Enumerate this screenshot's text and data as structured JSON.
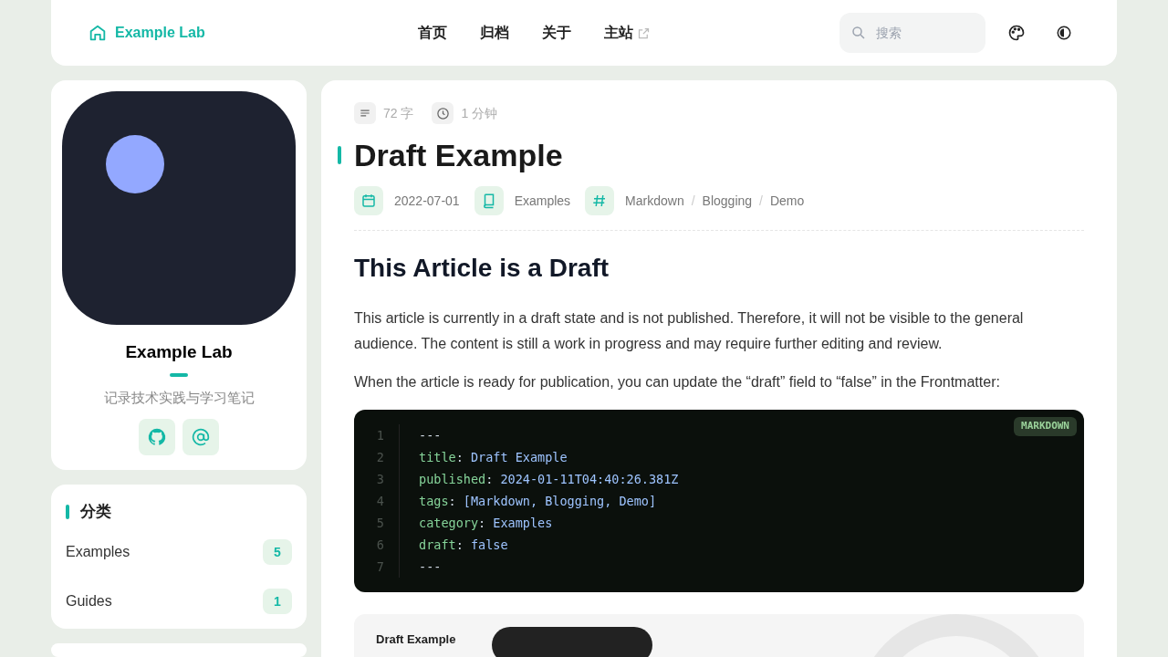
{
  "navbar": {
    "brand": "Example Lab",
    "links": [
      {
        "label": "首页",
        "external": false
      },
      {
        "label": "归档",
        "external": false
      },
      {
        "label": "关于",
        "external": false
      },
      {
        "label": "主站",
        "external": true
      }
    ],
    "search": {
      "placeholder": "搜索"
    }
  },
  "profile": {
    "name": "Example Lab",
    "bio": "记录技术实践与学习笔记"
  },
  "categories": {
    "title": "分类",
    "items": [
      {
        "name": "Examples",
        "count": "5"
      },
      {
        "name": "Guides",
        "count": "1"
      }
    ]
  },
  "post": {
    "words": "72 字",
    "reading_time": "1 分钟",
    "title": "Draft Example",
    "date": "2022-07-01",
    "category": "Examples",
    "tags": [
      "Markdown",
      "Blogging",
      "Demo"
    ],
    "tag_separator": "/",
    "heading": "This Article is a Draft",
    "paragraphs": [
      "This article is currently in a draft state and is not published. Therefore, it will not be visible to the general audience. The content is still a work in progress and may require further editing and review.",
      "When the article is ready for publication, you can update the “draft” field to “false” in the Frontmatter:"
    ],
    "code": {
      "language": "MARKDOWN",
      "lines": [
        {
          "number": "1",
          "value": "---"
        },
        {
          "number": "2",
          "key": "title",
          "colon": ":",
          "value": "Draft Example"
        },
        {
          "number": "3",
          "key": "published",
          "colon": ":",
          "value": "2024-01-11T04:40:26.381Z"
        },
        {
          "number": "4",
          "key": "tags",
          "colon": ":",
          "value": "[Markdown, Blogging, Demo]"
        },
        {
          "number": "5",
          "key": "category",
          "colon": ":",
          "value": "Examples"
        },
        {
          "number": "6",
          "key": "draft",
          "colon": ":",
          "value": "false"
        },
        {
          "number": "7",
          "value": "---"
        }
      ]
    },
    "preview_title": "Draft Example"
  }
}
